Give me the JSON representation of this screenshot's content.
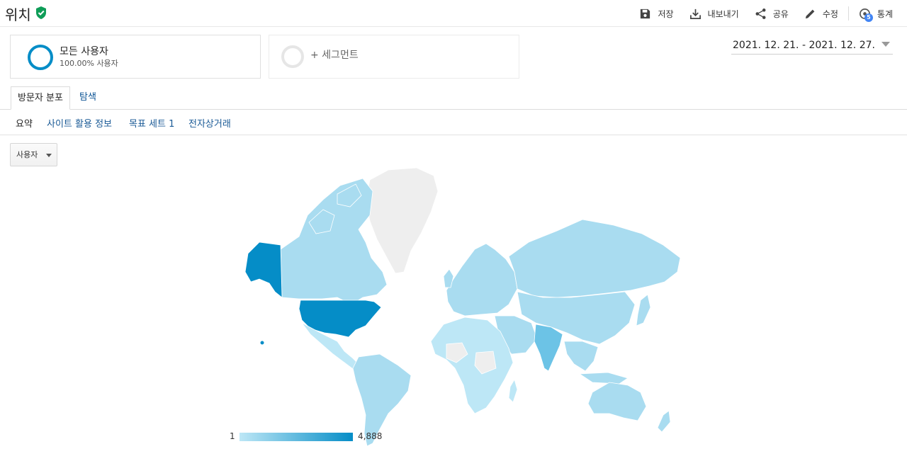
{
  "header": {
    "title": "위치",
    "actions": {
      "save": "저장",
      "export": "내보내기",
      "share": "공유",
      "edit": "수정",
      "insights": "통계",
      "insights_badge": "5"
    }
  },
  "segments": {
    "all_users": {
      "name": "모든 사용자",
      "sub": "100.00% 사용자"
    },
    "add_segment": "+ 세그먼트"
  },
  "date_range": "2021. 12. 21. - 2021. 12. 27.",
  "tabs": {
    "active": "방문자 분포",
    "explore": "탐색"
  },
  "subtabs": {
    "current": "요약",
    "site_usage": "사이트 활용 정보",
    "goal_set": "목표 세트 1",
    "ecommerce": "전자상거래"
  },
  "metric_select": "사용자",
  "legend": {
    "min": "1",
    "max": "4,888"
  },
  "colors": {
    "accent": "#058dc7",
    "light": "#bde7f6",
    "mid": "#7ccbe9",
    "no_data": "#eeeeee",
    "brand_green": "#0f9d58"
  }
}
